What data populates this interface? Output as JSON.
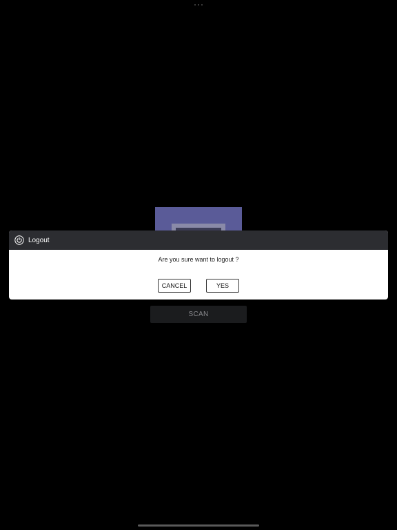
{
  "background": {
    "color": "#000000"
  },
  "app": {
    "scan_label": "SCAN"
  },
  "dialog": {
    "icon": "power-icon",
    "title": "Logout",
    "message": "Are you sure want to logout ?",
    "cancel_label": "CANCEL",
    "yes_label": "YES",
    "header_color": "#2c2d31"
  },
  "colors": {
    "logo_card": "#5a5b98",
    "scan_button": "#1b1c1e"
  }
}
